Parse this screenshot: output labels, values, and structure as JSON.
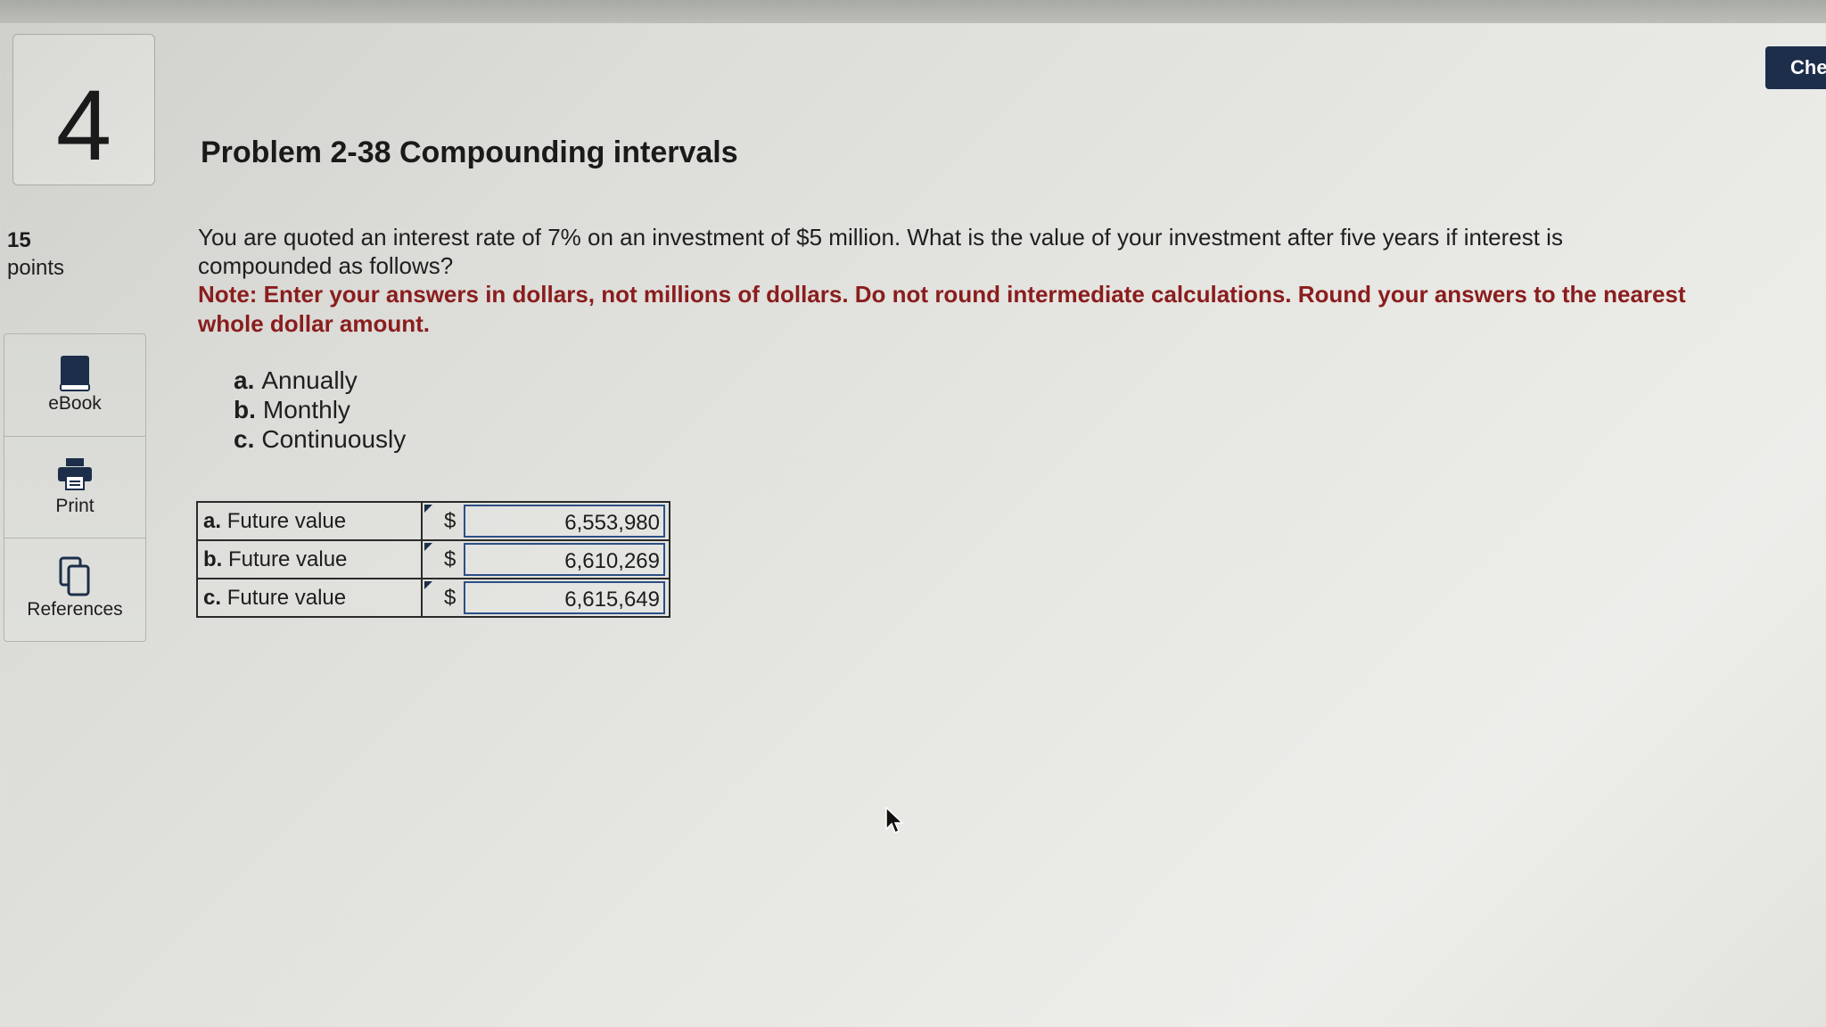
{
  "header": {
    "check_label": "Che"
  },
  "question": {
    "number": "4",
    "title": "Problem 2-38 Compounding intervals",
    "points_value": "15",
    "points_label": "points",
    "text": "You are quoted an interest rate of 7% on an investment of $5 million. What is the value of your investment after five years if interest is compounded as follows?",
    "note": "Note: Enter your answers in dollars, not millions of dollars. Do not round intermediate calculations. Round your answers to the nearest whole dollar amount.",
    "options": [
      {
        "letter": "a.",
        "text": "Annually"
      },
      {
        "letter": "b.",
        "text": "Monthly"
      },
      {
        "letter": "c.",
        "text": "Continuously"
      }
    ]
  },
  "tools": {
    "items": [
      {
        "label": "eBook",
        "icon": "book-icon"
      },
      {
        "label": "Print",
        "icon": "printer-icon"
      },
      {
        "label": "References",
        "icon": "copy-pages-icon"
      }
    ]
  },
  "answers": {
    "rows": [
      {
        "letter": "a.",
        "label": "Future value",
        "currency": "$",
        "value": "6,553,980"
      },
      {
        "letter": "b.",
        "label": "Future value",
        "currency": "$",
        "value": "6,610,269"
      },
      {
        "letter": "c.",
        "label": "Future value",
        "currency": "$",
        "value": "6,615,649"
      }
    ]
  },
  "colors": {
    "note_text": "#8a1d1d",
    "check_button_bg": "#1c2e4a",
    "input_border": "#2c4f86"
  }
}
